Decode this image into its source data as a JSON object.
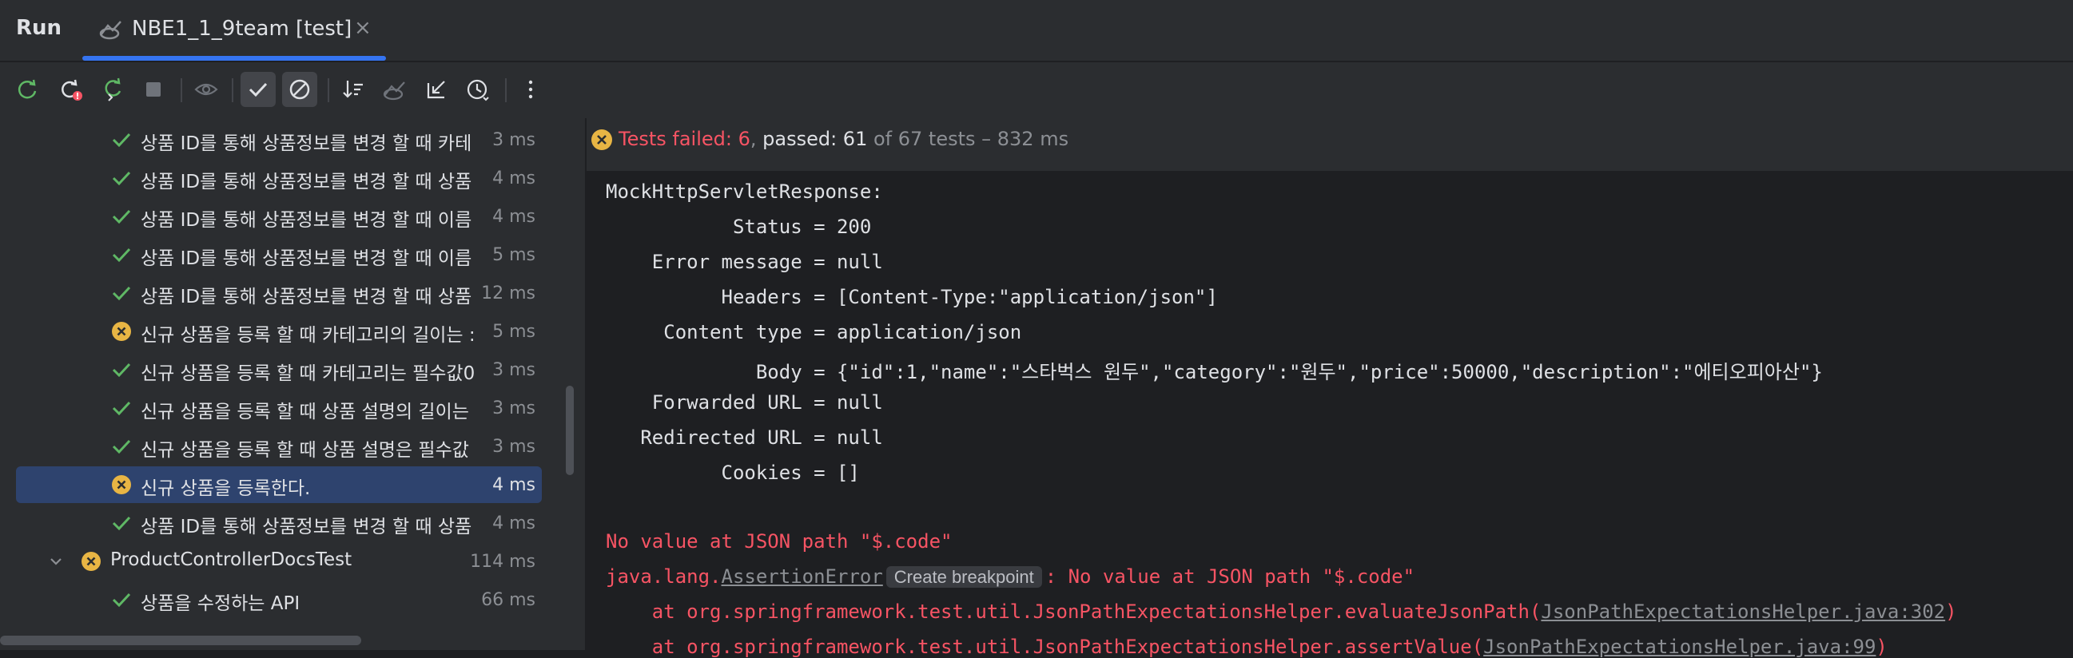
{
  "header": {
    "run_label": "Run",
    "tab_title": "NBE1_1_9team [test]",
    "close_glyph": "×"
  },
  "toolbar": {
    "buttons": [
      "rerun-icon",
      "rerun-failed-icon",
      "toggle-auto-test-icon",
      "stop-icon",
      "show-ignored-icon",
      "show-passed-icon",
      "show-ignored-tests-icon",
      "sort-icon",
      "import-tests-icon",
      "export-icon",
      "history-icon",
      "more-icon"
    ]
  },
  "tree": {
    "rows": [
      {
        "label": "상품 ID를 통해 상품정보를 변경 할 때 카테",
        "time": "3 ms",
        "status": "passed"
      },
      {
        "label": "상품 ID를 통해 상품정보를 변경 할 때 상품",
        "time": "4 ms",
        "status": "passed"
      },
      {
        "label": "상품 ID를 통해 상품정보를 변경 할 때 이름",
        "time": "4 ms",
        "status": "passed"
      },
      {
        "label": "상품 ID를 통해 상품정보를 변경 할 때 이름",
        "time": "5 ms",
        "status": "passed"
      },
      {
        "label": "상품 ID를 통해 상품정보를 변경 할 때 상품",
        "time": "12 ms",
        "status": "passed"
      },
      {
        "label": "신규 상품을 등록 할 때 카테고리의 길이는 :",
        "time": "5 ms",
        "status": "failed"
      },
      {
        "label": "신규 상품을 등록 할 때 카테고리는 필수값0",
        "time": "3 ms",
        "status": "passed"
      },
      {
        "label": "신규 상품을 등록 할 때 상품 설명의 길이는",
        "time": "3 ms",
        "status": "passed"
      },
      {
        "label": "신규 상품을 등록 할 때 상품 설명은 필수값",
        "time": "3 ms",
        "status": "passed"
      },
      {
        "label": "신규 상품을 등록한다.",
        "time": "4 ms",
        "status": "failed",
        "selected": true
      },
      {
        "label": "상품 ID를 통해 상품정보를 변경 할 때 상품",
        "time": "4 ms",
        "status": "passed"
      },
      {
        "label": "ProductControllerDocsTest",
        "time": "114 ms",
        "status": "failed",
        "group": true
      },
      {
        "label": "상품을 수정하는 API",
        "time": "66 ms",
        "status": "passed"
      }
    ]
  },
  "status": {
    "failed_text": "Tests failed: 6",
    "sep": ", ",
    "passed_text": "passed: 61",
    "rest_text": " of 67 tests – 832 ms"
  },
  "console": {
    "lines": [
      "MockHttpServletResponse:",
      "           Status = 200",
      "    Error message = null",
      "          Headers = [Content-Type:\"application/json\"]",
      "     Content type = application/json",
      "             Body = {\"id\":1,\"name\":\"스타벅스 원두\",\"category\":\"원두\",\"price\":50000,\"description\":\"에티오피아산\"}",
      "    Forwarded URL = null",
      "   Redirected URL = null",
      "          Cookies = []"
    ],
    "error_line": "No value at JSON path \"$.code\"",
    "assert_prefix": "java.lang.",
    "assert_class": "AssertionError",
    "breakpoint_chip": "Create breakpoint",
    "assert_suffix": ": No value at JSON path \"$.code\"",
    "stack1_prefix": "    at org.springframework.test.util.JsonPathExpectationsHelper.evaluateJsonPath(",
    "stack1_link": "JsonPathExpectationsHelper.java:302",
    "stack1_suffix": ")",
    "stack2_prefix": "    at org.springframework.test.util.JsonPathExpectationsHelper.assertValue(",
    "stack2_link": "JsonPathExpectationsHelper.java:99",
    "stack2_suffix": ")"
  },
  "colors": {
    "pass": "#5fb865",
    "fail": "#e8b544",
    "error_text": "#f75464",
    "accent": "#3574f0"
  }
}
